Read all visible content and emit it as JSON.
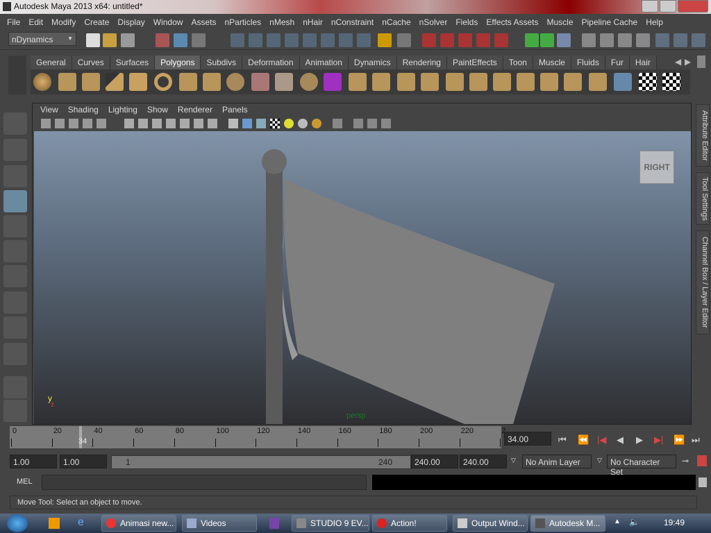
{
  "window": {
    "title": "Autodesk Maya 2013 x64: untitled*"
  },
  "menu": [
    "File",
    "Edit",
    "Modify",
    "Create",
    "Display",
    "Window",
    "Assets",
    "nParticles",
    "nMesh",
    "nHair",
    "nConstraint",
    "nCache",
    "nSolver",
    "Fields",
    "Effects Assets",
    "Muscle",
    "Pipeline Cache",
    "Help"
  ],
  "status_line": {
    "menu_set": "nDynamics"
  },
  "shelf": {
    "tabs": [
      "General",
      "Curves",
      "Surfaces",
      "Polygons",
      "Subdivs",
      "Deformation",
      "Animation",
      "Dynamics",
      "Rendering",
      "PaintEffects",
      "Toon",
      "Muscle",
      "Fluids",
      "Fur",
      "Hair"
    ],
    "active": "Polygons"
  },
  "panel": {
    "menu": [
      "View",
      "Shading",
      "Lighting",
      "Show",
      "Renderer",
      "Panels"
    ],
    "camera": "persp",
    "viewcube": "RIGHT",
    "axis_y": "y",
    "axis_z": "z"
  },
  "right_tabs": [
    "Attribute Editor",
    "Tool Settings",
    "Channel Box / Layer Editor"
  ],
  "time_slider": {
    "ticks": [
      "0",
      "20",
      "40",
      "60",
      "80",
      "100",
      "120",
      "140",
      "160",
      "180",
      "200",
      "220",
      "2"
    ],
    "current_marker": "34",
    "current_time": "34.00"
  },
  "range": {
    "start": "1.00",
    "playback_start": "1.00",
    "slider_start": "1",
    "slider_end": "240",
    "playback_end": "240.00",
    "end": "240.00",
    "anim_layer": "No Anim Layer",
    "character_set": "No Character Set"
  },
  "command_line": {
    "label": "MEL",
    "input": ""
  },
  "help_line": "Move Tool: Select an object to move.",
  "taskbar": {
    "items": [
      "Animasi new...",
      "Videos",
      "",
      "STUDIO 9 EV...",
      "Action!",
      "Output Wind...",
      "Autodesk M..."
    ],
    "clock": "19:49"
  }
}
